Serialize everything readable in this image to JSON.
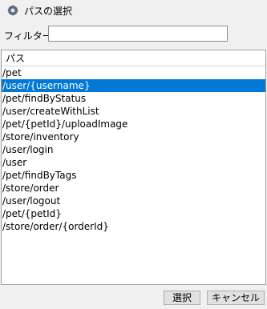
{
  "window": {
    "title": "パスの選択",
    "icon": "app-gear-icon"
  },
  "filter": {
    "label": "フィルター:",
    "value": "",
    "placeholder": ""
  },
  "list": {
    "column_header": "パス",
    "selected_index": 1,
    "items": [
      "/pet",
      "/user/{username}",
      "/pet/findByStatus",
      "/user/createWithList",
      "/pet/{petId}/uploadImage",
      "/store/inventory",
      "/user/login",
      "/user",
      "/pet/findByTags",
      "/store/order",
      "/user/logout",
      "/pet/{petId}",
      "/store/order/{orderId}"
    ]
  },
  "buttons": {
    "select_label": "選択",
    "cancel_label": "キャンセル"
  },
  "colors": {
    "selection": "#0078d7",
    "background": "#f0f0f0"
  }
}
